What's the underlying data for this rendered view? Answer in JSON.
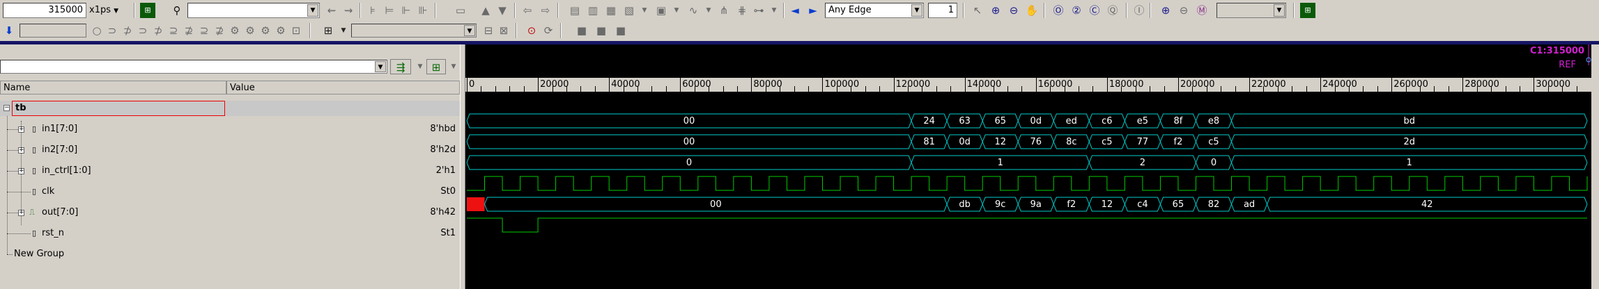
{
  "toolbar": {
    "time_value": "315000",
    "time_unit": "x1ps",
    "search_text": "",
    "edge_mode": "Any Edge",
    "edge_count": "1",
    "zoom_value": ""
  },
  "left_pane": {
    "col_name": "Name",
    "col_value": "Value",
    "top_group": "tb",
    "signals": [
      {
        "name": "in1[7:0]",
        "value": "8'hbd"
      },
      {
        "name": "in2[7:0]",
        "value": "8'h2d"
      },
      {
        "name": "in_ctrl[1:0]",
        "value": "2'h1"
      },
      {
        "name": "clk",
        "value": "St0"
      },
      {
        "name": "out[7:0]",
        "value": "8'h42"
      },
      {
        "name": "rst_n",
        "value": "St1"
      }
    ],
    "new_group": "New Group"
  },
  "wave": {
    "cursor_label": "C1:315000",
    "ref_label": "REF",
    "time_max": 315000,
    "ticks": [
      "0",
      "20000",
      "40000",
      "60000",
      "80000",
      "100000",
      "120000",
      "140000",
      "160000",
      "180000",
      "200000",
      "220000",
      "240000",
      "260000",
      "280000",
      "300000"
    ],
    "tick_values": [
      0,
      20000,
      40000,
      60000,
      80000,
      100000,
      120000,
      140000,
      160000,
      180000,
      200000,
      220000,
      240000,
      260000,
      280000,
      300000
    ],
    "buses": {
      "in1": {
        "transitions": [
          0,
          125000,
          135000,
          145000,
          155000,
          165000,
          175000,
          185000,
          195000,
          205000,
          215000,
          315000
        ],
        "labels": [
          "00",
          "24",
          "63",
          "65",
          "0d",
          "ed",
          "c6",
          "e5",
          "8f",
          "e8",
          "bd"
        ]
      },
      "in2": {
        "transitions": [
          0,
          125000,
          135000,
          145000,
          155000,
          165000,
          175000,
          185000,
          195000,
          205000,
          215000,
          315000
        ],
        "labels": [
          "00",
          "81",
          "0d",
          "12",
          "76",
          "8c",
          "c5",
          "77",
          "f2",
          "c5",
          "2d"
        ]
      },
      "in_ctrl": {
        "transitions": [
          0,
          125000,
          175000,
          205000,
          215000,
          315000
        ],
        "labels": [
          "0",
          "1",
          "2",
          "0",
          "1"
        ]
      },
      "out": {
        "transitions": [
          0,
          5000,
          135000,
          145000,
          155000,
          165000,
          175000,
          185000,
          195000,
          205000,
          215000,
          225000,
          315000
        ],
        "labels": [
          "",
          "00",
          "db",
          "9c",
          "9a",
          "f2",
          "12",
          "c4",
          "65",
          "82",
          "ad",
          "42"
        ],
        "unknown_until": 5000
      }
    },
    "clk_period": 10000,
    "rst_low": [
      10000,
      20000
    ]
  },
  "colors": {
    "wave_bg": "#000000",
    "bus": "#00cccc",
    "clk": "#00cc00",
    "unknown": "#ee1111",
    "cursor": "#d020d0",
    "selection": "#ee0000"
  }
}
